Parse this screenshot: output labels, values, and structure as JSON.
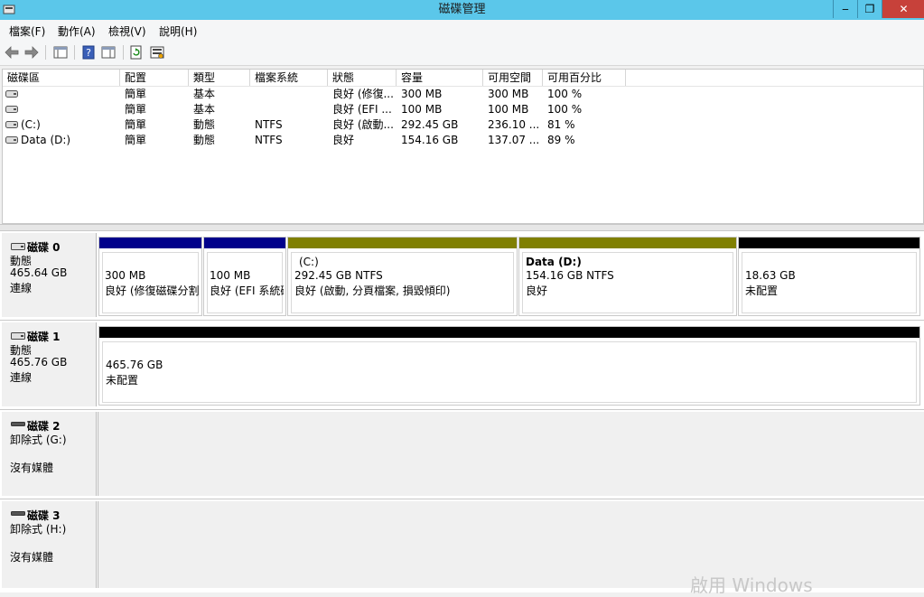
{
  "window": {
    "title": "磁碟管理",
    "min_label": "‒",
    "max_label": "❐",
    "close_label": "✕"
  },
  "menu": [
    "檔案(F)",
    "動作(A)",
    "檢視(V)",
    "說明(H)"
  ],
  "toolbar_icons": [
    "back-arrow-icon",
    "forward-arrow-icon",
    "show-hide-console-tree-icon",
    "help-icon",
    "properties-icon",
    "refresh-icon",
    "rescan-disks-icon"
  ],
  "volume_table": {
    "headers": [
      "磁碟區",
      "配置",
      "類型",
      "檔案系統",
      "狀態",
      "容量",
      "可用空間",
      "可用百分比"
    ],
    "rows": [
      [
        "",
        "簡單",
        "基本",
        "",
        "良好 (修復...",
        "300 MB",
        "300 MB",
        "100 %"
      ],
      [
        "",
        "簡單",
        "基本",
        "",
        "良好 (EFI ...",
        "100 MB",
        "100 MB",
        "100 %"
      ],
      [
        "(C:)",
        "簡單",
        "動態",
        "NTFS",
        "良好 (啟動...",
        "292.45 GB",
        "236.10 ...",
        "81 %"
      ],
      [
        "Data (D:)",
        "簡單",
        "動態",
        "NTFS",
        "良好",
        "154.16 GB",
        "137.07 ...",
        "89 %"
      ]
    ]
  },
  "disks": [
    {
      "name": "磁碟 0",
      "type": "動態",
      "size": "465.64 GB",
      "status": "連線",
      "partitions": [
        {
          "title": "",
          "size": "300 MB",
          "status": "良好 (修復磁碟分割)",
          "bar_color": "#00008b"
        },
        {
          "title": "",
          "size": "100 MB",
          "status": "良好 (EFI 系統磁碟分割)",
          "bar_color": "#00008b"
        },
        {
          "title": "(C:)",
          "size": "292.45 GB NTFS",
          "status": "良好 (啟動, 分頁檔案, 損毀傾印)",
          "bar_color": "#808000"
        },
        {
          "title": "Data  (D:)",
          "size": "154.16 GB NTFS",
          "status": "良好",
          "bar_color": "#808000"
        },
        {
          "title": "",
          "size": "18.63 GB",
          "status": "未配置",
          "bar_color": "#000000"
        }
      ]
    },
    {
      "name": "磁碟 1",
      "type": "動態",
      "size": "465.76 GB",
      "status": "連線",
      "partitions": [
        {
          "title": "",
          "size": "465.76 GB",
          "status": "未配置",
          "bar_color": "#000000"
        }
      ]
    },
    {
      "name": "磁碟 2",
      "type": "卸除式 (G:)",
      "status": "沒有媒體"
    },
    {
      "name": "磁碟 3",
      "type": "卸除式 (H:)",
      "status": "沒有媒體"
    }
  ],
  "watermark": "啟用 Windows"
}
